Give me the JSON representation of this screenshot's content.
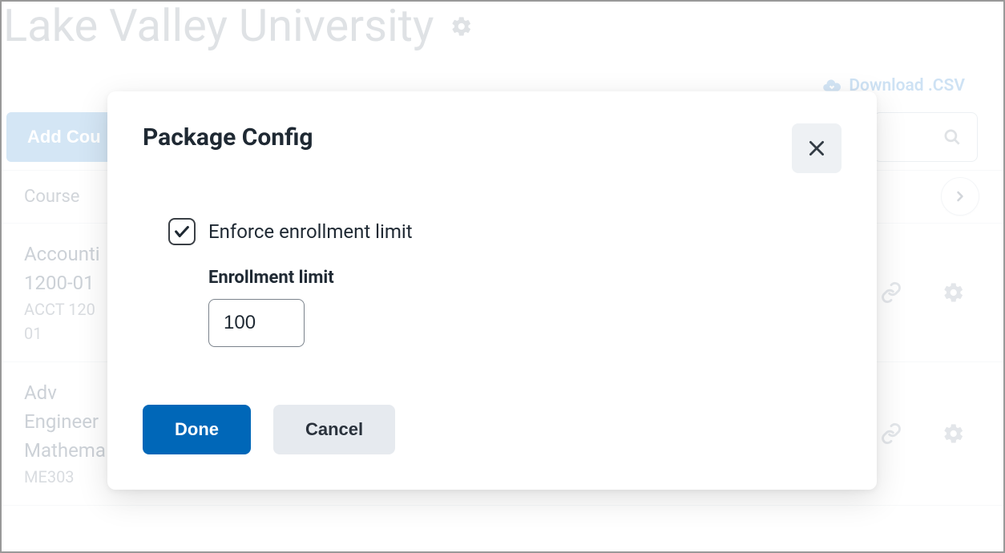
{
  "page": {
    "title": "Lake Valley University",
    "download_label": "Download .CSV",
    "add_course_label": "Add Cou",
    "table_header_course": "Course"
  },
  "rows": [
    {
      "line1": "Accounti",
      "line2": "1200-01",
      "line3": "ACCT 120",
      "line4": "01"
    },
    {
      "line1": "Adv",
      "line2": "Engineer",
      "line3": "Mathema",
      "line4": "ME303"
    }
  ],
  "modal": {
    "title": "Package Config",
    "checkbox_label": "Enforce enrollment limit",
    "enrollment_label": "Enrollment limit",
    "enrollment_value": "100",
    "done_label": "Done",
    "cancel_label": "Cancel"
  },
  "icons": {
    "gear": "gear-icon",
    "cloud_download": "cloud-download-icon",
    "search": "search-icon",
    "chevron_right": "chevron-right-icon",
    "link": "link-icon",
    "close": "close-icon",
    "check": "check-icon"
  }
}
